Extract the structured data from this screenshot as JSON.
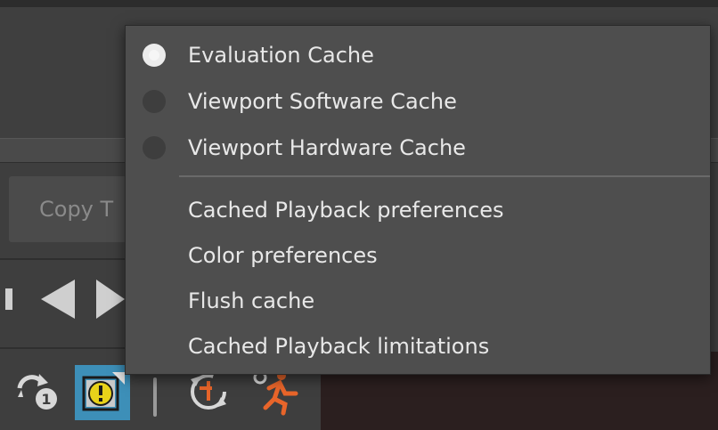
{
  "background": {
    "copy_button_label": "Copy T",
    "toolbar_icons": [
      "loop-once-icon",
      "cache-warning-icon",
      "cache-refresh-icon",
      "running-man-icon"
    ],
    "transport_icons": [
      "step-back-icon",
      "play-back-icon",
      "play-forward-icon"
    ]
  },
  "menu": {
    "radio_items": [
      {
        "label": "Evaluation Cache",
        "selected": true
      },
      {
        "label": "Viewport Software Cache",
        "selected": false
      },
      {
        "label": "Viewport Hardware Cache",
        "selected": false
      }
    ],
    "action_items": [
      {
        "label": "Cached Playback preferences"
      },
      {
        "label": "Color preferences"
      },
      {
        "label": "Flush cache"
      },
      {
        "label": "Cached Playback limitations"
      }
    ]
  },
  "colors": {
    "active_icon_bg": "#3d8fb8",
    "warning_yellow": "#e8d21a",
    "running_orange": "#e8652a"
  }
}
